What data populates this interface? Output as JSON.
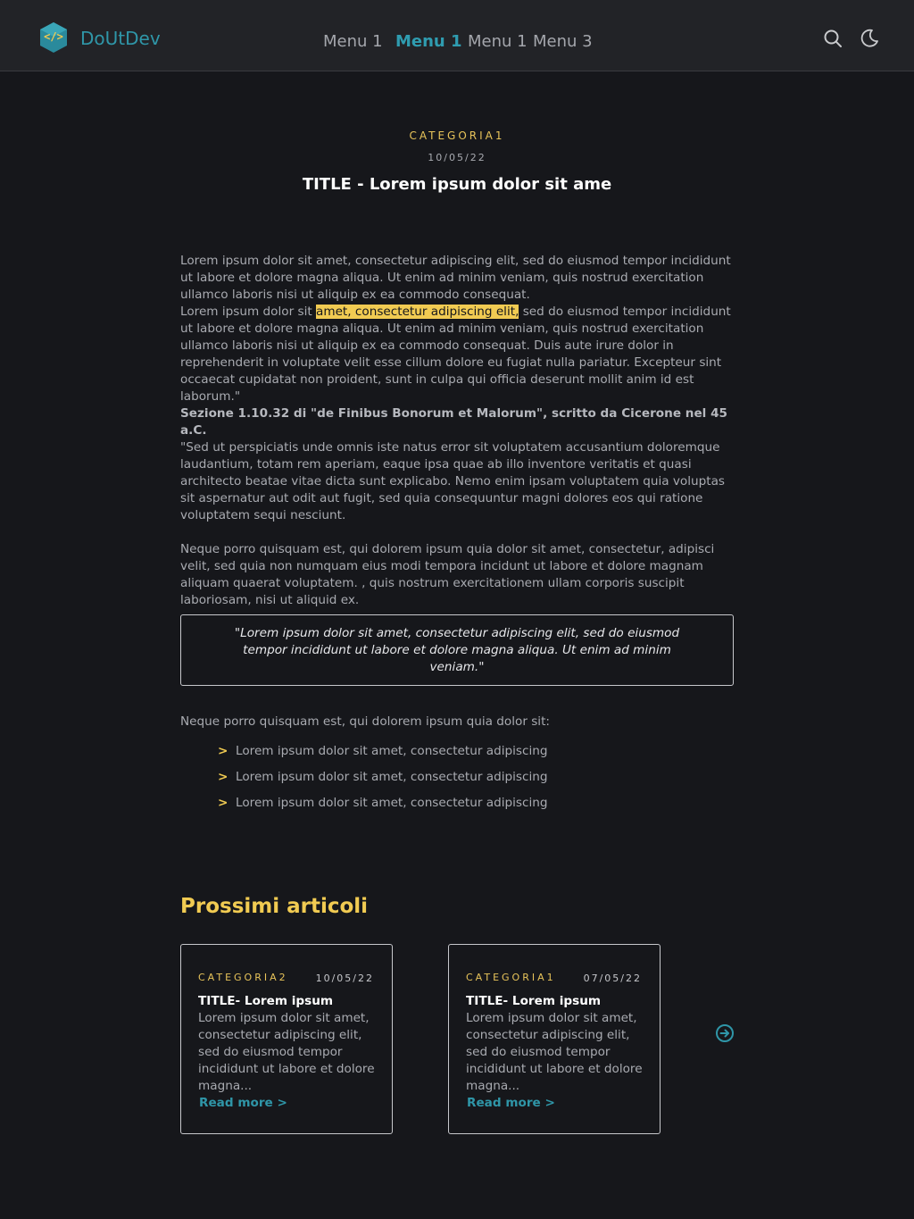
{
  "header": {
    "brand": "DoUtDev",
    "nav": [
      {
        "label": "Menu 1",
        "active": false
      },
      {
        "label": "Menu 1",
        "active": true
      },
      {
        "label": "Menu 1",
        "active": false
      },
      {
        "label": "Menu 3",
        "active": false
      }
    ],
    "icons": [
      "logo-icon",
      "search-icon",
      "moon-icon"
    ]
  },
  "article": {
    "category": "CATEGORIA1",
    "date": "10/05/22",
    "title": "TITLE - Lorem ipsum dolor sit ame",
    "p1": "Lorem ipsum dolor sit amet, consectetur adipiscing elit, sed do eiusmod tempor incididunt ut labore et dolore magna aliqua. Ut enim ad minim veniam, quis nostrud exercitation ullamco laboris nisi ut aliquip ex ea commodo consequat.",
    "p2_before": "Lorem ipsum dolor sit ",
    "p2_highlight": "amet, consectetur adipiscing elit,",
    "p2_after": " sed do eiusmod tempor incididunt ut labore et dolore magna aliqua. Ut enim ad minim veniam, quis nostrud exercitation ullamco laboris nisi ut aliquip ex ea commodo consequat. Duis aute irure dolor in reprehenderit in voluptate velit esse cillum dolore eu fugiat nulla pariatur. Excepteur sint occaecat cupidatat non proident, sunt in culpa qui officia deserunt mollit anim id est laborum.\"",
    "section_heading": "Sezione 1.10.32 di \"de Finibus Bonorum et Malorum\", scritto da Cicerone nel 45 a.C.",
    "p3": "\"Sed ut perspiciatis unde omnis iste natus error sit voluptatem accusantium doloremque laudantium, totam rem aperiam, eaque ipsa quae ab illo inventore veritatis et quasi architecto beatae vitae dicta sunt explicabo. Nemo enim ipsam voluptatem quia voluptas sit aspernatur aut odit aut fugit, sed quia consequuntur magni dolores eos qui ratione voluptatem sequi nesciunt.",
    "p4": "Neque porro quisquam est, qui dolorem ipsum quia dolor sit amet, consectetur, adipisci velit, sed quia non numquam eius modi tempora incidunt ut labore et dolore magnam aliquam quaerat voluptatem. , quis nostrum exercitationem ullam corporis suscipit laboriosam, nisi ut aliquid ex.",
    "quote": "\"Lorem ipsum dolor sit amet, consectetur adipiscing elit, sed do eiusmod tempor incididunt ut labore et dolore magna aliqua. Ut enim ad minim veniam.\"",
    "list_intro": "Neque porro quisquam est, qui dolorem ipsum quia dolor sit:",
    "list_bullet": ">",
    "list": [
      "Lorem ipsum dolor sit amet, consectetur adipiscing",
      "Lorem ipsum dolor sit amet, consectetur adipiscing",
      "Lorem ipsum dolor sit amet, consectetur adipiscing"
    ]
  },
  "next": {
    "heading": "Prossimi articoli",
    "cards": [
      {
        "category": "CATEGORIA2",
        "date": "10/05/22",
        "title": "TITLE- Lorem ipsum",
        "excerpt": "Lorem ipsum dolor sit amet, consectetur adipiscing elit, sed do eiusmod tempor incididunt ut labore et dolore magna...",
        "more": "Read more >"
      },
      {
        "category": "CATEGORIA1",
        "date": "07/05/22",
        "title": "TITLE- Lorem ipsum",
        "excerpt": "Lorem ipsum dolor sit amet, consectetur adipiscing elit, sed do eiusmod tempor incididunt ut labore et dolore magna...",
        "more": "Read more >"
      }
    ],
    "next_icon": "arrow-right-circle-icon"
  },
  "colors": {
    "background": "#16171b",
    "header": "#222327",
    "accent_teal": "#2f96a8",
    "accent_yellow": "#f1cb52"
  }
}
